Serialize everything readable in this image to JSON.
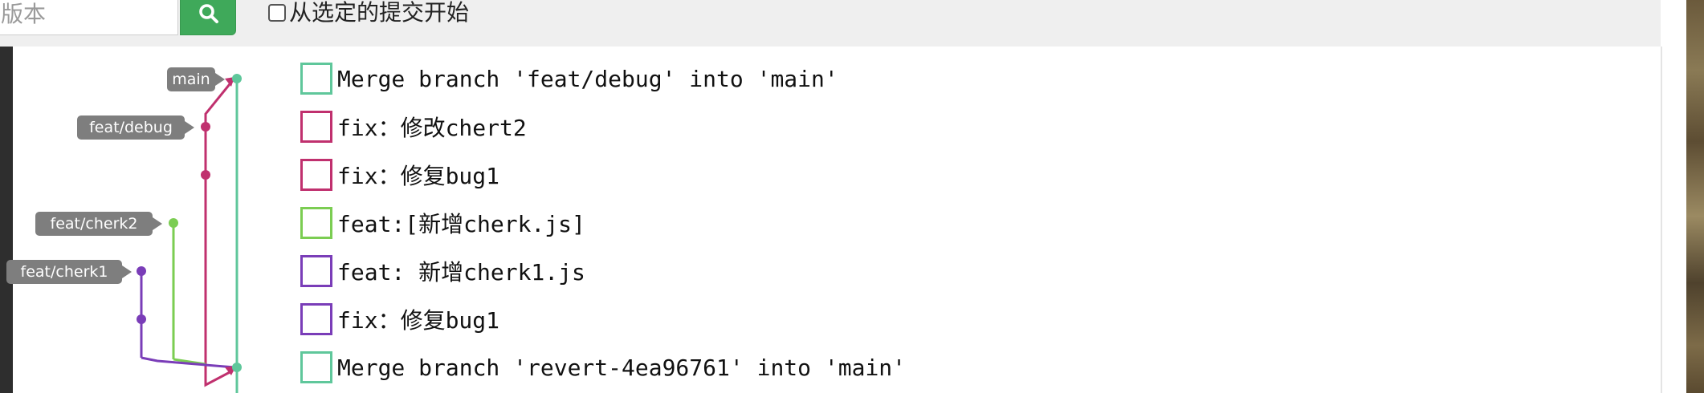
{
  "toolbar": {
    "version_placeholder": "版本",
    "search_icon": "search-icon",
    "start_from_selected_label": "从选定的提交开始",
    "start_from_selected_checked": false
  },
  "branches": [
    {
      "name": "main",
      "color": "#5fc79b"
    },
    {
      "name": "feat/debug",
      "color": "#c0306e"
    },
    {
      "name": "feat/cherk2",
      "color": "#7bcd52"
    },
    {
      "name": "feat/cherk1",
      "color": "#7a3db8"
    }
  ],
  "commits": [
    {
      "message": "Merge branch 'feat/debug' into 'main'",
      "color": "#5fc79b"
    },
    {
      "message": "fix：修改chert2",
      "color": "#c0306e"
    },
    {
      "message": "fix：修复bug1",
      "color": "#c0306e"
    },
    {
      "message": "feat:[新增cherk.js]",
      "color": "#7bcd52"
    },
    {
      "message": "feat: 新增cherk1.js",
      "color": "#7a3db8"
    },
    {
      "message": "fix：修复bug1",
      "color": "#7a3db8"
    },
    {
      "message": "Merge branch 'revert-4ea96761' into 'main'",
      "color": "#5fc79b"
    }
  ]
}
